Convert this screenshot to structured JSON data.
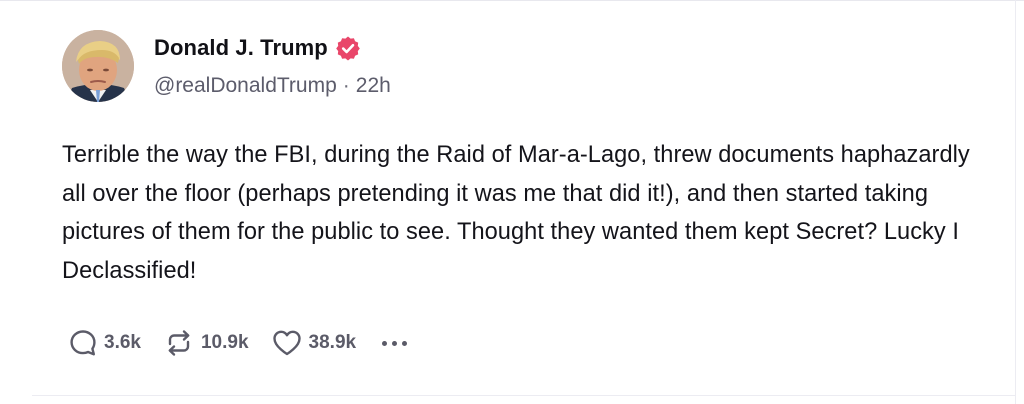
{
  "post": {
    "author": {
      "display_name": "Donald J. Trump",
      "handle": "@realDonaldTrump",
      "verified": true,
      "verified_color": "#e9466a",
      "avatar_icon": "profile-photo"
    },
    "separator": "·",
    "time": "22h",
    "text": "Terrible the way the FBI, during the Raid of Mar-a-Lago, threw documents haphazardly all over the floor (perhaps pretending it was me that did it!), and then started taking pictures of them for the public to see. Thought they wanted them kept Secret? Lucky I Declassified!",
    "actions": {
      "reply_count": "3.6k",
      "retruth_count": "10.9k",
      "like_count": "38.9k",
      "reply_icon": "speech-bubble-icon",
      "retruth_icon": "repost-arrows-icon",
      "like_icon": "heart-icon",
      "more_icon": "ellipsis-icon"
    }
  },
  "colors": {
    "text": "#14141a",
    "muted": "#5c5c6b",
    "divider": "#ececf2"
  }
}
